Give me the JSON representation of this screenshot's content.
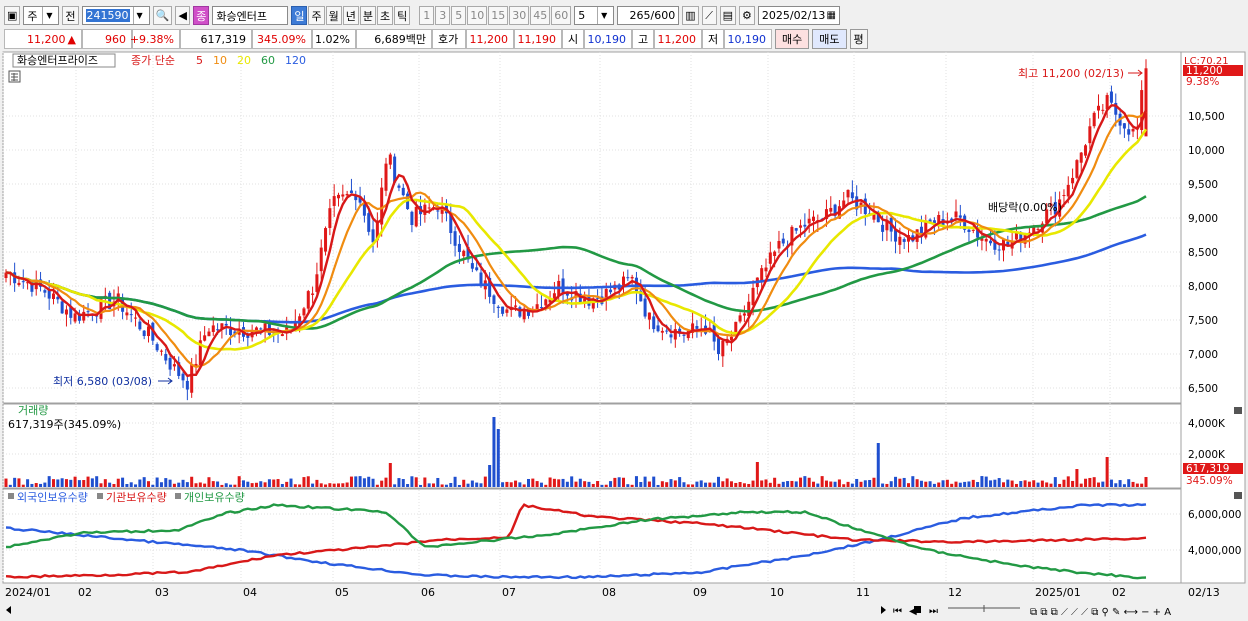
{
  "toolbar": {
    "market": "주",
    "market_mode": "전",
    "code": "241590",
    "name_badge": "종",
    "stock_name": "화승엔터프",
    "periods": [
      "일",
      "주",
      "월",
      "년",
      "분",
      "초",
      "틱"
    ],
    "active_period": "일",
    "minutes": [
      "1",
      "3",
      "5",
      "10",
      "15",
      "30",
      "45",
      "60"
    ],
    "min_select": "5",
    "count": "265",
    "count_max": "/600",
    "date": "2025/02/13"
  },
  "quote": {
    "price": "11,200",
    "arrow": "▲",
    "change": "960",
    "change_pct": "+9.38%",
    "volume": "617,319",
    "volume_pct": "345.09%",
    "turnover": "1.02%",
    "amount": "6,689백만",
    "ask_label": "호가",
    "ask": "11,200",
    "bid": "11,190",
    "open_label": "시",
    "open": "10,190",
    "high_label": "고",
    "high": "11,200",
    "low_label": "저",
    "low": "10,190",
    "buy": "매수",
    "sell": "매도",
    "avg": "평"
  },
  "price_panel": {
    "title": "화승엔터프라이즈",
    "ma_label": "종가 단순",
    "ma_periods": [
      "5",
      "10",
      "20",
      "60",
      "120"
    ],
    "ma_colors": [
      "#d81818",
      "#f08c10",
      "#e8e800",
      "#229944",
      "#2a5ce0"
    ],
    "high_marker": "최고 11,200 (02/13)",
    "low_marker": "최저 6,580 (03/08)",
    "dividend_marker": "배당락(0.00%)",
    "lc_label": "LC:70.21",
    "last_price": "11,200",
    "last_pct": "9.38%",
    "y_ticks": [
      "10,500",
      "10,000",
      "9,500",
      "9,000",
      "8,500",
      "8,000",
      "7,500",
      "7,000",
      "6,500"
    ]
  },
  "volume_panel": {
    "title": "거래량",
    "value": "617,319주(345.09%)",
    "y_ticks": [
      "4,000K",
      "2,000K"
    ],
    "last_value": "617,319",
    "last_pct": "345.09%"
  },
  "holdings_panel": {
    "legend": [
      "외국인보유수량",
      "기관보유수량",
      "개인보유수량"
    ],
    "legend_colors": [
      "#2a5ce0",
      "#d81818",
      "#229944"
    ],
    "y_ticks": [
      "6,000,000",
      "4,000,000"
    ]
  },
  "x_axis": {
    "labels": [
      "2024/01",
      "02",
      "03",
      "04",
      "05",
      "06",
      "07",
      "08",
      "09",
      "10",
      "11",
      "12",
      "2025/01",
      "02"
    ],
    "last_date": "02/13"
  },
  "chart_data": {
    "type": "line",
    "x_range": [
      "2024/01",
      "2025/02/13"
    ],
    "ylim": [
      6300,
      11600
    ],
    "close_keypoints": [
      {
        "x": "2024/01",
        "y": 8200
      },
      {
        "x": "02",
        "y": 7800
      },
      {
        "x": "03",
        "y": 6800
      },
      {
        "x": "03/08",
        "y": 6580
      },
      {
        "x": "04",
        "y": 7300
      },
      {
        "x": "05",
        "y": 9300
      },
      {
        "x": "06",
        "y": 9200
      },
      {
        "x": "07",
        "y": 7700
      },
      {
        "x": "08",
        "y": 7900
      },
      {
        "x": "09",
        "y": 7500
      },
      {
        "x": "10",
        "y": 8900
      },
      {
        "x": "11",
        "y": 9100
      },
      {
        "x": "12",
        "y": 8800
      },
      {
        "x": "2025/01",
        "y": 8700
      },
      {
        "x": "02",
        "y": 10300
      },
      {
        "x": "02/13",
        "y": 11200
      }
    ]
  }
}
